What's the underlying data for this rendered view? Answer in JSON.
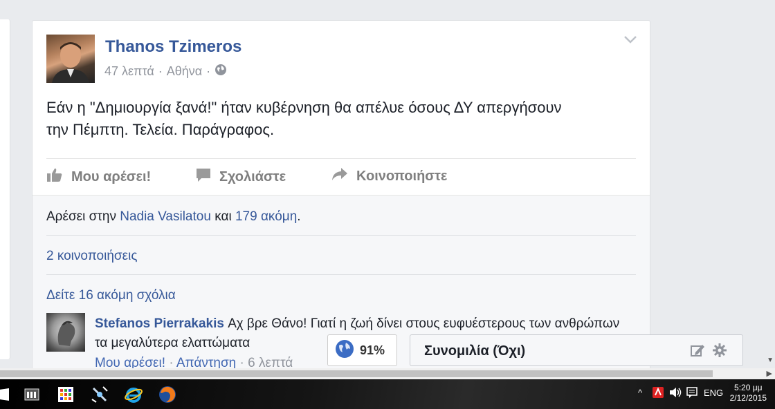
{
  "post": {
    "author": "Thanos Tzimeros",
    "time": "47 λεπτά",
    "separator": "·",
    "location": "Αθήνα",
    "privacy_icon": "globe-icon",
    "text_line1": "Εάν η \"Δημιουργία ξανά!\" ήταν κυβέρνηση θα απέλυε όσους ΔΥ απεργήσουν",
    "text_line2": "την Πέμπτη. Τελεία. Παράγραφος."
  },
  "actions": {
    "like": "Μου αρέσει!",
    "comment": "Σχολιάστε",
    "share": "Κοινοποιήστε"
  },
  "feedback": {
    "likes_prefix": "Αρέσει στην",
    "likes_name": "Nadia Vasilatou",
    "likes_and": "και",
    "likes_more": "179 ακόμη",
    "likes_end": ".",
    "shares": "2 κοινοποιήσεις",
    "more_comments": "Δείτε 16 ακόμη σχόλια"
  },
  "comment": {
    "author": "Stefanos Pierrakakis",
    "text": "Αχ βρε Θάνο! Γιατί η ζωή δίνει στους ευφυέστερους των ανθρώπων τα μεγαλύτερα ελαττώματα",
    "like": "Μου αρέσει!",
    "reply": "Απάντηση",
    "sep": "·",
    "time": "6 λεπτά"
  },
  "presence": {
    "value": "91%"
  },
  "chat": {
    "label": "Συνομιλία (Όχι)"
  },
  "taskbar": {
    "language": "ENG",
    "time": "5:20 μμ",
    "date": "2/12/2015"
  },
  "colors": {
    "link": "#365899",
    "muted": "#90949c",
    "background": "#e9ebee"
  }
}
